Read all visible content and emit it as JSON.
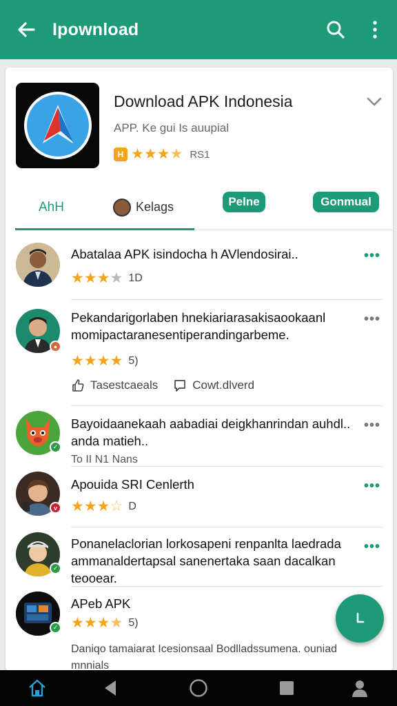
{
  "topbar": {
    "title": "Ipownload",
    "back_icon": "arrow-left-icon",
    "search_icon": "search-icon",
    "menu_icon": "more-vert-icon"
  },
  "app": {
    "name": "Download APK Indonesia",
    "subtitle": "APP. Ke gui Is auupial",
    "badge": "H",
    "rating_count": "RS1",
    "stars": 3.5
  },
  "tabs": {
    "active": "AhH",
    "second": "Kelags",
    "pill1": "Pelne",
    "pill2": "Gonmual"
  },
  "items": [
    {
      "text": "Abatalaa APK isindocha h AVlendosirai..",
      "stars": 3,
      "count": "1D"
    },
    {
      "text": "Pekandarigorlaben hnekiariarasakisaookaanl momipactaranesentiperandingarbeme.",
      "stars": 4,
      "count": "5)",
      "action1": "Tasestcaeals",
      "action2": "Cowt.dlverd"
    },
    {
      "text": "Bayoidaanekaah aabadiai deigkhanrindan auhdl.. anda matieh..",
      "sub": "To II N1 Nans"
    },
    {
      "text": "Apouida SRI Cenlerth",
      "stars": 3.5,
      "count": "D"
    },
    {
      "text": "Ponanelaclorian lorkosapeni renpanlta laedrada ammanaldertapsal sanenertaka saan dacalkan teooear."
    },
    {
      "text": "APeb APK",
      "stars": 3.5,
      "count": "5)",
      "sub": "Daniqo tamaiarat Icesionsaal Bodlladssumena. ouniad mnnials"
    }
  ],
  "colors": {
    "primary": "#1d9a78",
    "star": "#f4a41c",
    "navbar": "#040404"
  },
  "nav": [
    "home-icon",
    "back-triangle-icon",
    "circle-home-icon",
    "square-recents-icon",
    "profile-icon"
  ]
}
